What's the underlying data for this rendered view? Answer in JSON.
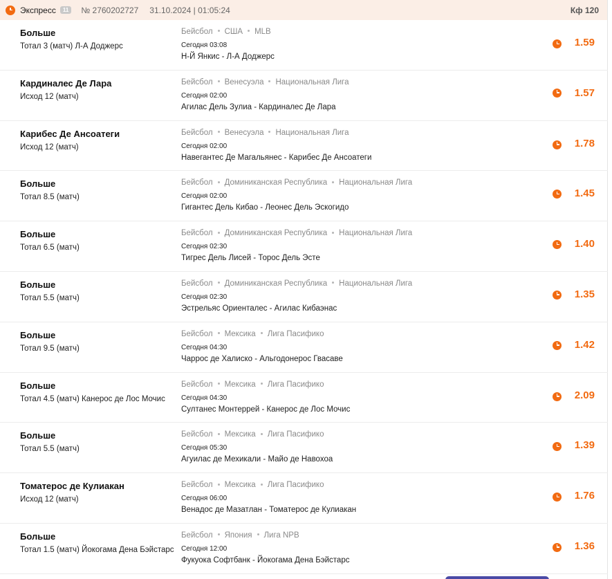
{
  "header": {
    "type": "Экспресс",
    "count": "11",
    "number": "№ 2760202727",
    "datetime": "31.10.2024 | 01:05:24",
    "coef": "Кф 120"
  },
  "bets": [
    {
      "selection": "Больше",
      "market": "Тотал 3 (матч) Л-А Доджерс",
      "sport": "Бейсбол",
      "country": "США",
      "league": "MLB",
      "time": "Сегодня 03:08",
      "match": "Н-Й Янкис - Л-А Доджерс",
      "odds": "1.59"
    },
    {
      "selection": "Кардиналес Де Лара",
      "market": "Исход 12 (матч)",
      "sport": "Бейсбол",
      "country": "Венесуэла",
      "league": "Национальная Лига",
      "time": "Сегодня 02:00",
      "match": "Агилас Дель Зулиа - Кардиналес Де Лара",
      "odds": "1.57"
    },
    {
      "selection": "Карибес Де Ансоатеги",
      "market": "Исход 12 (матч)",
      "sport": "Бейсбол",
      "country": "Венесуэла",
      "league": "Национальная Лига",
      "time": "Сегодня 02:00",
      "match": "Навегантес Де Магальянес - Карибес Де Ансоатеги",
      "odds": "1.78"
    },
    {
      "selection": "Больше",
      "market": "Тотал 8.5 (матч)",
      "sport": "Бейсбол",
      "country": "Доминиканская Республика",
      "league": "Национальная Лига",
      "time": "Сегодня 02:00",
      "match": "Гигантес Дель Кибао - Леонес Дель Эскогидо",
      "odds": "1.45"
    },
    {
      "selection": "Больше",
      "market": "Тотал 6.5 (матч)",
      "sport": "Бейсбол",
      "country": "Доминиканская Республика",
      "league": "Национальная Лига",
      "time": "Сегодня 02:30",
      "match": "Тигрес Дель Лисей - Торос Дель Эсте",
      "odds": "1.40"
    },
    {
      "selection": "Больше",
      "market": "Тотал 5.5 (матч)",
      "sport": "Бейсбол",
      "country": "Доминиканская Республика",
      "league": "Национальная Лига",
      "time": "Сегодня 02:30",
      "match": "Эстрельяс Ориенталес - Агилас Кибаэнас",
      "odds": "1.35"
    },
    {
      "selection": "Больше",
      "market": "Тотал 9.5 (матч)",
      "sport": "Бейсбол",
      "country": "Мексика",
      "league": "Лига Пасифико",
      "time": "Сегодня 04:30",
      "match": "Чаррос де Халиско - Альгодонерос Гвасаве",
      "odds": "1.42"
    },
    {
      "selection": "Больше",
      "market": "Тотал 4.5 (матч) Канерос де Лос Мочис",
      "sport": "Бейсбол",
      "country": "Мексика",
      "league": "Лига Пасифико",
      "time": "Сегодня 04:30",
      "match": "Султанес Монтеррей - Канерос де Лос Мочис",
      "odds": "2.09"
    },
    {
      "selection": "Больше",
      "market": "Тотал 5.5 (матч)",
      "sport": "Бейсбол",
      "country": "Мексика",
      "league": "Лига Пасифико",
      "time": "Сегодня 05:30",
      "match": "Агуилас де Мехикали - Майо де Навохоа",
      "odds": "1.39"
    },
    {
      "selection": "Томатерос де Кулиакан",
      "market": "Исход 12 (матч)",
      "sport": "Бейсбол",
      "country": "Мексика",
      "league": "Лига Пасифико",
      "time": "Сегодня 06:00",
      "match": "Венадос де Мазатлан - Томатерос де Кулиакан",
      "odds": "1.76"
    },
    {
      "selection": "Больше",
      "market": "Тотал 1.5 (матч) Йокогама Дена Бэйстарс",
      "sport": "Бейсбол",
      "country": "Япония",
      "league": "Лига NPB",
      "time": "Сегодня 12:00",
      "match": "Фукуока Софтбанк - Йокогама Дена Бэйстарс",
      "odds": "1.36"
    }
  ]
}
